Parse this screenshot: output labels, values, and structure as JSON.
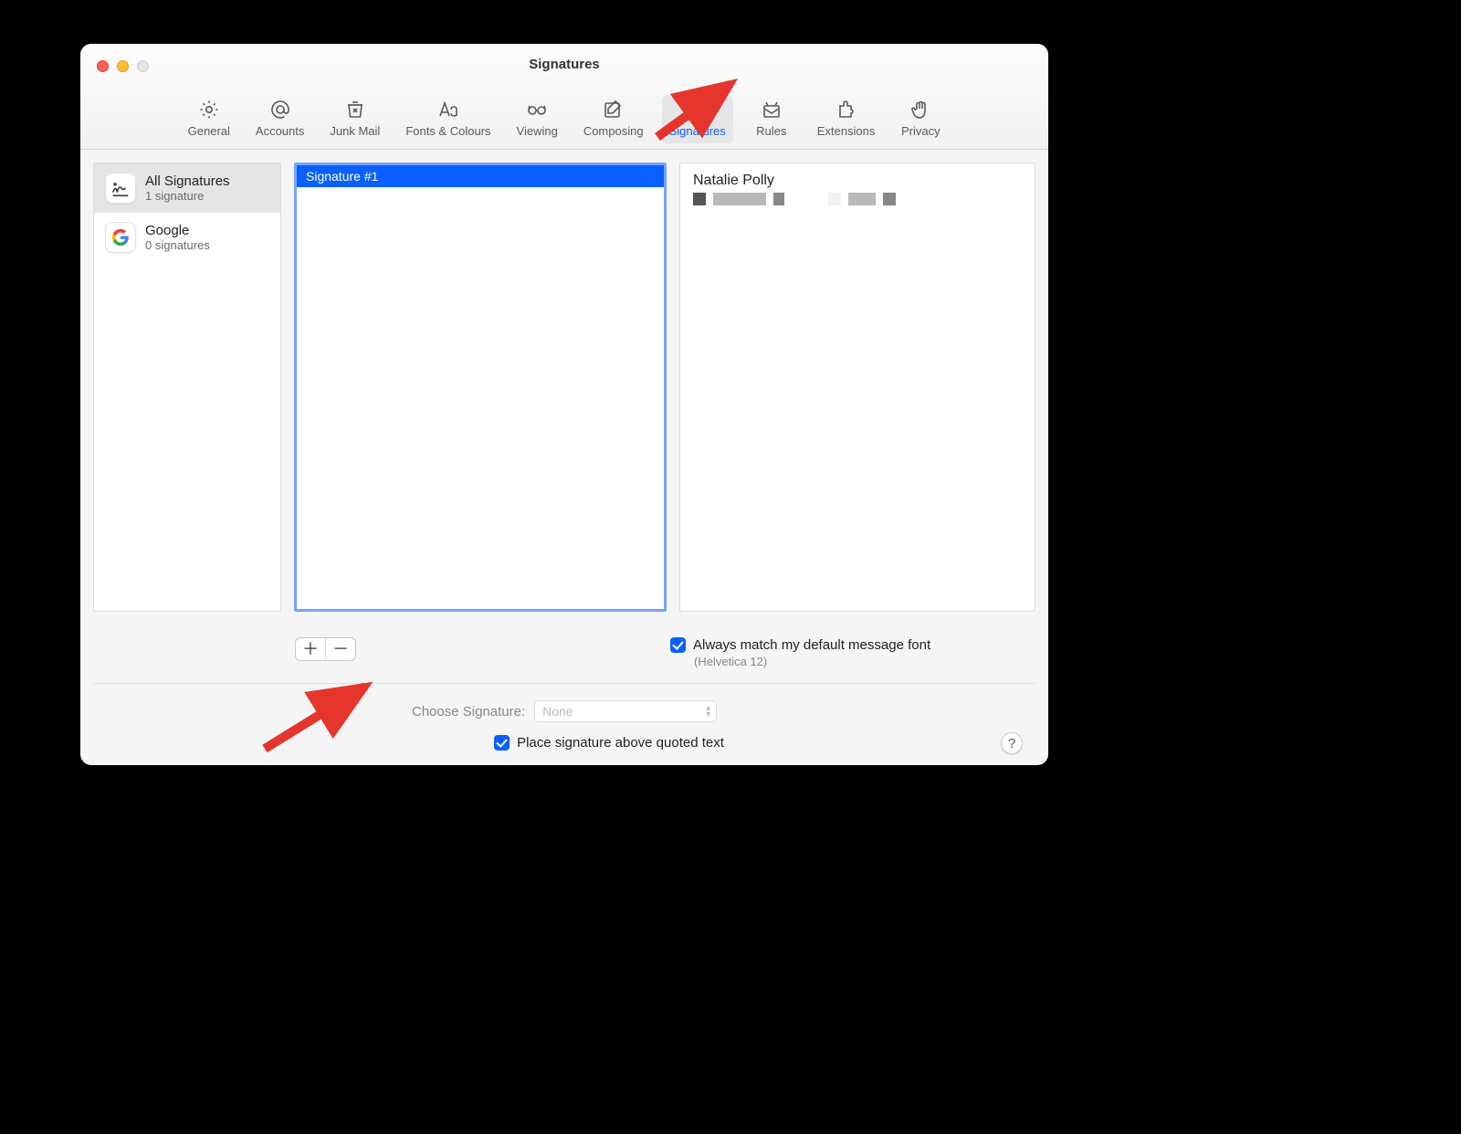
{
  "window": {
    "title": "Signatures"
  },
  "tabs": {
    "general": "General",
    "accounts": "Accounts",
    "junk": "Junk Mail",
    "fonts": "Fonts & Colours",
    "viewing": "Viewing",
    "composing": "Composing",
    "signatures": "Signatures",
    "rules": "Rules",
    "extensions": "Extensions",
    "privacy": "Privacy"
  },
  "accounts": [
    {
      "name": "All Signatures",
      "sub": "1 signature"
    },
    {
      "name": "Google",
      "sub": "0 signatures"
    }
  ],
  "signatures": [
    {
      "name": "Signature #1"
    }
  ],
  "preview": {
    "name": "Natalie Polly"
  },
  "options": {
    "match_font_label": "Always match my default message font",
    "match_font_sub": "(Helvetica 12)",
    "choose_label": "Choose Signature:",
    "choose_value": "None",
    "place_label": "Place signature above quoted text"
  }
}
